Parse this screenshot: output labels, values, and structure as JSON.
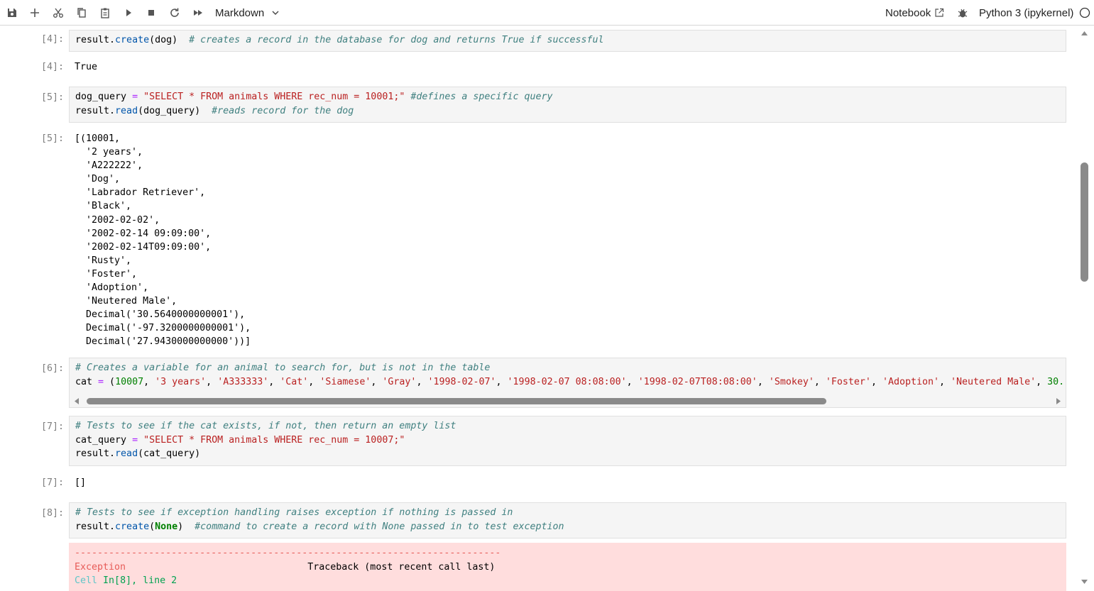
{
  "toolbar": {
    "icons": [
      "save-icon",
      "add-icon",
      "cut-icon",
      "copy-icon",
      "paste-icon",
      "run-icon",
      "stop-icon",
      "restart-icon",
      "fast-forward-icon"
    ],
    "cell_type": "Markdown",
    "notebook_label": "Notebook",
    "kernel": "Python 3 (ipykernel)"
  },
  "cells": {
    "c4": {
      "in_prompt": "[4]:",
      "out_prompt": "[4]:",
      "output": "True"
    },
    "c5": {
      "in_prompt": "[5]:",
      "out_prompt": "[5]:",
      "output": "[(10001,\n  '2 years',\n  'A222222',\n  'Dog',\n  'Labrador Retriever',\n  'Black',\n  '2002-02-02',\n  '2002-02-14 09:09:00',\n  '2002-02-14T09:09:00',\n  'Rusty',\n  'Foster',\n  'Adoption',\n  'Neutered Male',\n  Decimal('30.5640000000001'),\n  Decimal('-97.3200000000001'),\n  Decimal('27.9430000000000'))]"
    },
    "c6": {
      "in_prompt": "[6]:"
    },
    "c7": {
      "in_prompt": "[7]:",
      "out_prompt": "[7]:",
      "output": "[]"
    },
    "c8": {
      "in_prompt": "[8]:",
      "err_rule": "---------------------------------------------------------------------------",
      "err_name": "Exception",
      "err_trace": "Traceback (most recent call last)",
      "err_cell": "Cell",
      "err_in": "In[8], line 2"
    }
  },
  "code": {
    "c4_l1_a": "result.",
    "c4_l1_fn": "create",
    "c4_l1_b": "(dog)  ",
    "c4_l1_com": "# creates a record in the database for dog and returns True if successful",
    "c5_l1_a": "dog_query ",
    "c5_l1_op": "=",
    "c5_l1_str": "\"SELECT * FROM animals WHERE rec_num = 10001;\"",
    "c5_l1_com": "#defines a specific query",
    "c5_l2_a": "result.",
    "c5_l2_fn": "read",
    "c5_l2_b": "(dog_query)  ",
    "c5_l2_com": "#reads record for the dog",
    "c6_l1_com": "# Creates a variable for an animal to search for, but is not in the table",
    "c6_l2_a": "cat ",
    "c6_l2_op": "=",
    "c6_l2_b": " (",
    "c6_l2_num": "10007",
    "c6_v1": "'3 years'",
    "c6_v2": "'A333333'",
    "c6_v3": "'Cat'",
    "c6_v4": "'Siamese'",
    "c6_v5": "'Gray'",
    "c6_v6": "'1998-02-07'",
    "c6_v7": "'1998-02-07 08:08:00'",
    "c6_v8": "'1998-02-07T08:08:00'",
    "c6_v9": "'Smokey'",
    "c6_v10": "'Foster'",
    "c6_v11": "'Adoption'",
    "c6_v12": "'Neutered Male'",
    "c6_tail": "30.",
    "c7_l1_com": "# Tests to see if the cat exists, if not, then return an empty list",
    "c7_l2_a": "cat_query ",
    "c7_l2_op": "=",
    "c7_l2_str": "\"SELECT * FROM animals WHERE rec_num = 10007;\"",
    "c7_l3_a": "result.",
    "c7_l3_fn": "read",
    "c7_l3_b": "(cat_query)",
    "c8_l1_com": "# Tests to see if exception handling raises exception if nothing is passed in",
    "c8_l2_a": "result.",
    "c8_l2_fn": "create",
    "c8_l2_b": "(",
    "c8_l2_kw": "None",
    "c8_l2_c": ")  ",
    "c8_l2_com": "#command to create a record with None passed in to test exception"
  },
  "colors": {
    "comment": "#408080",
    "string": "#ba2121",
    "function": "#0055aa",
    "operator": "#aa22ff",
    "number": "#008000",
    "error_bg": "#ffdddd"
  }
}
